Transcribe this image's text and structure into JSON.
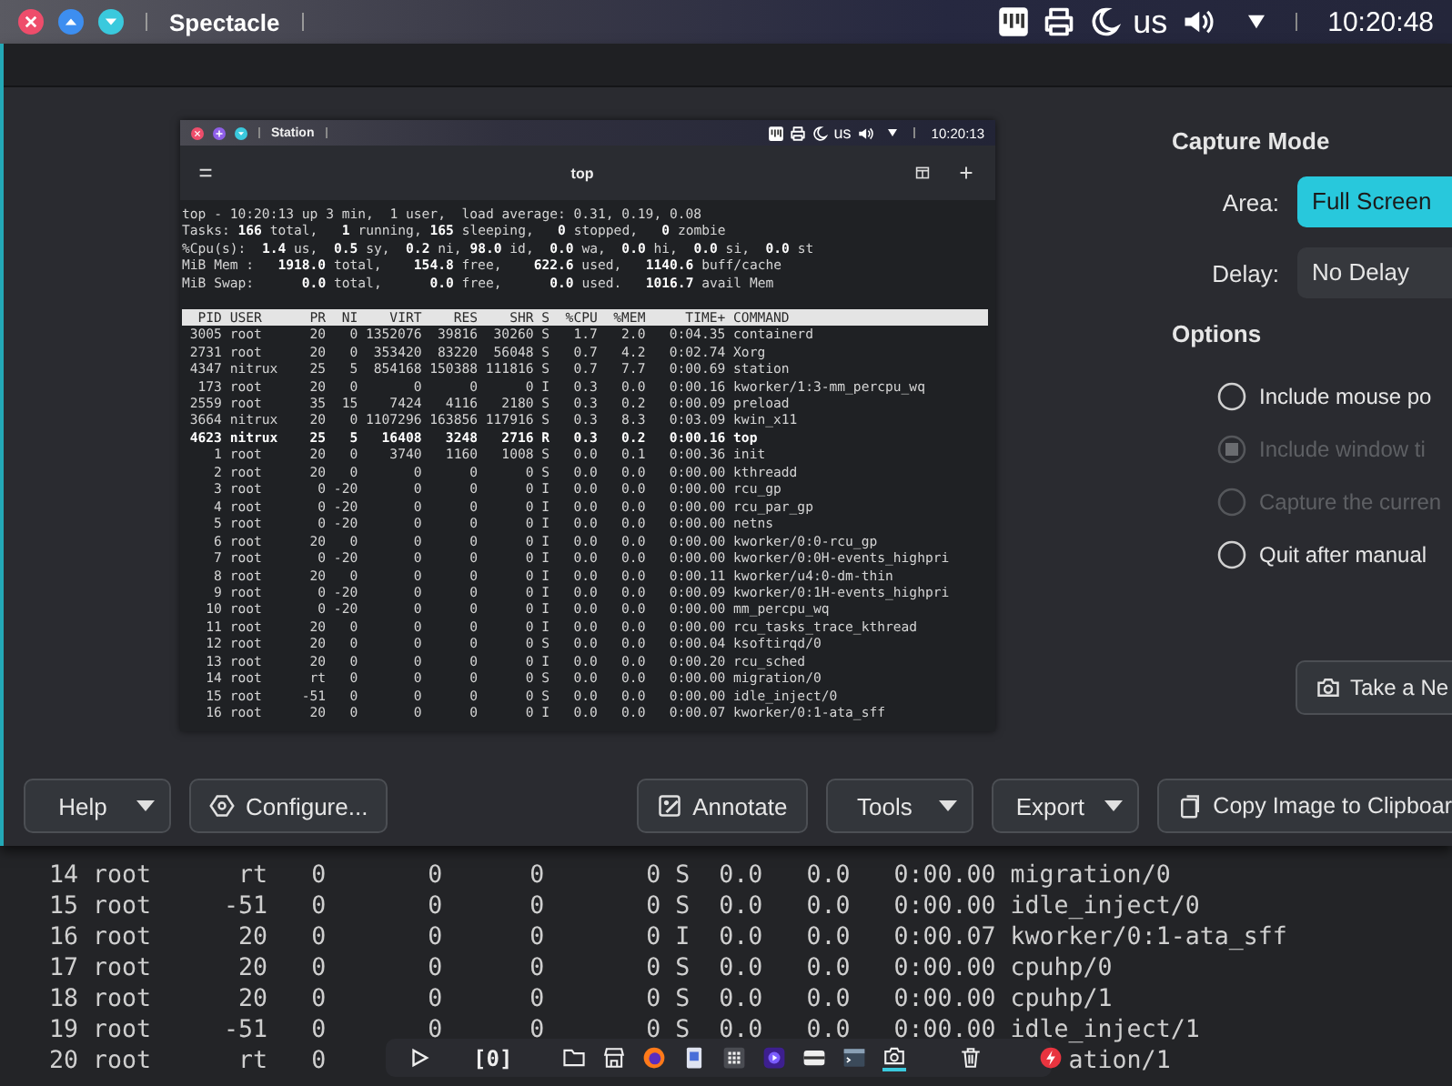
{
  "top_panel": {
    "title": "Spectacle",
    "keyboard_layout": "us",
    "clock": "10:20:48"
  },
  "preview": {
    "top_panel": {
      "title": "Station",
      "keyboard_layout": "us",
      "clock": "10:20:13"
    },
    "terminal_title": "top",
    "summary": [
      "top - 10:20:13 up 3 min,  1 user,  load average: 0.31, 0.19, 0.08",
      "Tasks: **166** total,   **1** running, **165** sleeping,   **0** stopped,   **0** zombie",
      "%Cpu(s):  **1.4** us,  **0.5** sy,  **0.2** ni, **98.0** id,  **0.0** wa,  **0.0** hi,  **0.0** si,  **0.0** st",
      "MiB Mem :   **1918.0** total,    **154.8** free,    **622.6** used,   **1140.6** buff/cache",
      "MiB Swap:      **0.0** total,      **0.0** free,      **0.0** used.   **1016.7** avail Mem"
    ],
    "columns": [
      "PID",
      "USER",
      "PR",
      "NI",
      "VIRT",
      "RES",
      "SHR",
      "S",
      "%CPU",
      "%MEM",
      "TIME+",
      "COMMAND"
    ],
    "rows": [
      {
        "cells": [
          "3005",
          "root",
          "20",
          "0",
          "1352076",
          "39816",
          "30260",
          "S",
          "1.7",
          "2.0",
          "0:04.35",
          "containerd"
        ],
        "highlighted": false
      },
      {
        "cells": [
          "2731",
          "root",
          "20",
          "0",
          "353420",
          "83220",
          "56048",
          "S",
          "0.7",
          "4.2",
          "0:02.74",
          "Xorg"
        ],
        "highlighted": false
      },
      {
        "cells": [
          "4347",
          "nitrux",
          "25",
          "5",
          "854168",
          "150388",
          "111816",
          "S",
          "0.7",
          "7.7",
          "0:00.69",
          "station"
        ],
        "highlighted": false
      },
      {
        "cells": [
          "173",
          "root",
          "20",
          "0",
          "0",
          "0",
          "0",
          "I",
          "0.3",
          "0.0",
          "0:00.16",
          "kworker/1:3-mm_percpu_wq"
        ],
        "highlighted": false
      },
      {
        "cells": [
          "2559",
          "root",
          "35",
          "15",
          "7424",
          "4116",
          "2180",
          "S",
          "0.3",
          "0.2",
          "0:00.09",
          "preload"
        ],
        "highlighted": false
      },
      {
        "cells": [
          "3664",
          "nitrux",
          "20",
          "0",
          "1107296",
          "163856",
          "117916",
          "S",
          "0.3",
          "8.3",
          "0:03.09",
          "kwin_x11"
        ],
        "highlighted": false
      },
      {
        "cells": [
          "4623",
          "nitrux",
          "25",
          "5",
          "16408",
          "3248",
          "2716",
          "R",
          "0.3",
          "0.2",
          "0:00.16",
          "top"
        ],
        "highlighted": true
      },
      {
        "cells": [
          "1",
          "root",
          "20",
          "0",
          "3740",
          "1160",
          "1008",
          "S",
          "0.0",
          "0.1",
          "0:00.36",
          "init"
        ],
        "highlighted": false
      },
      {
        "cells": [
          "2",
          "root",
          "20",
          "0",
          "0",
          "0",
          "0",
          "S",
          "0.0",
          "0.0",
          "0:00.00",
          "kthreadd"
        ],
        "highlighted": false
      },
      {
        "cells": [
          "3",
          "root",
          "0",
          "-20",
          "0",
          "0",
          "0",
          "I",
          "0.0",
          "0.0",
          "0:00.00",
          "rcu_gp"
        ],
        "highlighted": false
      },
      {
        "cells": [
          "4",
          "root",
          "0",
          "-20",
          "0",
          "0",
          "0",
          "I",
          "0.0",
          "0.0",
          "0:00.00",
          "rcu_par_gp"
        ],
        "highlighted": false
      },
      {
        "cells": [
          "5",
          "root",
          "0",
          "-20",
          "0",
          "0",
          "0",
          "I",
          "0.0",
          "0.0",
          "0:00.00",
          "netns"
        ],
        "highlighted": false
      },
      {
        "cells": [
          "6",
          "root",
          "20",
          "0",
          "0",
          "0",
          "0",
          "I",
          "0.0",
          "0.0",
          "0:00.00",
          "kworker/0:0-rcu_gp"
        ],
        "highlighted": false
      },
      {
        "cells": [
          "7",
          "root",
          "0",
          "-20",
          "0",
          "0",
          "0",
          "I",
          "0.0",
          "0.0",
          "0:00.00",
          "kworker/0:0H-events_highpri"
        ],
        "highlighted": false
      },
      {
        "cells": [
          "8",
          "root",
          "20",
          "0",
          "0",
          "0",
          "0",
          "I",
          "0.0",
          "0.0",
          "0:00.11",
          "kworker/u4:0-dm-thin"
        ],
        "highlighted": false
      },
      {
        "cells": [
          "9",
          "root",
          "0",
          "-20",
          "0",
          "0",
          "0",
          "I",
          "0.0",
          "0.0",
          "0:00.09",
          "kworker/0:1H-events_highpri"
        ],
        "highlighted": false
      },
      {
        "cells": [
          "10",
          "root",
          "0",
          "-20",
          "0",
          "0",
          "0",
          "I",
          "0.0",
          "0.0",
          "0:00.00",
          "mm_percpu_wq"
        ],
        "highlighted": false
      },
      {
        "cells": [
          "11",
          "root",
          "20",
          "0",
          "0",
          "0",
          "0",
          "I",
          "0.0",
          "0.0",
          "0:00.00",
          "rcu_tasks_trace_kthread"
        ],
        "highlighted": false
      },
      {
        "cells": [
          "12",
          "root",
          "20",
          "0",
          "0",
          "0",
          "0",
          "S",
          "0.0",
          "0.0",
          "0:00.04",
          "ksoftirqd/0"
        ],
        "highlighted": false
      },
      {
        "cells": [
          "13",
          "root",
          "20",
          "0",
          "0",
          "0",
          "0",
          "I",
          "0.0",
          "0.0",
          "0:00.20",
          "rcu_sched"
        ],
        "highlighted": false
      },
      {
        "cells": [
          "14",
          "root",
          "rt",
          "0",
          "0",
          "0",
          "0",
          "S",
          "0.0",
          "0.0",
          "0:00.00",
          "migration/0"
        ],
        "highlighted": false
      },
      {
        "cells": [
          "15",
          "root",
          "-51",
          "0",
          "0",
          "0",
          "0",
          "S",
          "0.0",
          "0.0",
          "0:00.00",
          "idle_inject/0"
        ],
        "highlighted": false
      },
      {
        "cells": [
          "16",
          "root",
          "20",
          "0",
          "0",
          "0",
          "0",
          "I",
          "0.0",
          "0.0",
          "0:00.07",
          "kworker/0:1-ata_sff"
        ],
        "highlighted": false
      }
    ]
  },
  "capture_mode": {
    "heading": "Capture Mode",
    "fields": [
      {
        "label": "Area:",
        "value": "Full Screen",
        "focused": true
      },
      {
        "label": "Delay:",
        "value": "No Delay",
        "focused": false
      }
    ]
  },
  "options": {
    "heading": "Options",
    "items": [
      {
        "label": "Include mouse po",
        "checked": false,
        "disabled": false
      },
      {
        "label": "Include window ti",
        "checked": true,
        "disabled": true
      },
      {
        "label": "Capture the curren",
        "checked": false,
        "disabled": true
      },
      {
        "label": "Quit after manual",
        "checked": false,
        "disabled": false
      }
    ]
  },
  "take_button": "Take a Ne",
  "buttons": [
    {
      "label": "Help",
      "menu": true
    },
    {
      "label": "Configure...",
      "menu": false
    },
    {
      "label": "Annotate",
      "menu": false
    },
    {
      "label": "Tools",
      "menu": true
    },
    {
      "label": "Export",
      "menu": true
    },
    {
      "label": "Copy Image to Clipboar",
      "menu": false
    }
  ],
  "terminal": {
    "rows": [
      {
        "cells": [
          "14",
          "root",
          "rt",
          "0",
          "0",
          "0",
          "0",
          "S",
          "0.0",
          "0.0",
          "0:00.00"
        ],
        "command": "migration/0",
        "covered": false
      },
      {
        "cells": [
          "15",
          "root",
          "-51",
          "0",
          "0",
          "0",
          "0",
          "S",
          "0.0",
          "0.0",
          "0:00.00"
        ],
        "command": "idle_inject/0",
        "covered": false
      },
      {
        "cells": [
          "16",
          "root",
          "20",
          "0",
          "0",
          "0",
          "0",
          "I",
          "0.0",
          "0.0",
          "0:00.07"
        ],
        "command": "kworker/0:1-ata_sff",
        "covered": false
      },
      {
        "cells": [
          "17",
          "root",
          "20",
          "0",
          "0",
          "0",
          "0",
          "S",
          "0.0",
          "0.0",
          "0:00.00"
        ],
        "command": "cpuhp/0",
        "covered": false
      },
      {
        "cells": [
          "18",
          "root",
          "20",
          "0",
          "0",
          "0",
          "0",
          "S",
          "0.0",
          "0.0",
          "0:00.00"
        ],
        "command": "cpuhp/1",
        "covered": false
      },
      {
        "cells": [
          "19",
          "root",
          "-51",
          "0",
          "0",
          "0",
          "0",
          "S",
          "0.0",
          "0.0",
          "0:00.00"
        ],
        "command": "idle_inject/1",
        "covered": false
      },
      {
        "cells": [
          "20",
          "root",
          "rt",
          "0"
        ],
        "command": "ation/1",
        "covered": true
      }
    ]
  },
  "dock": {
    "workspace": "[0]"
  }
}
